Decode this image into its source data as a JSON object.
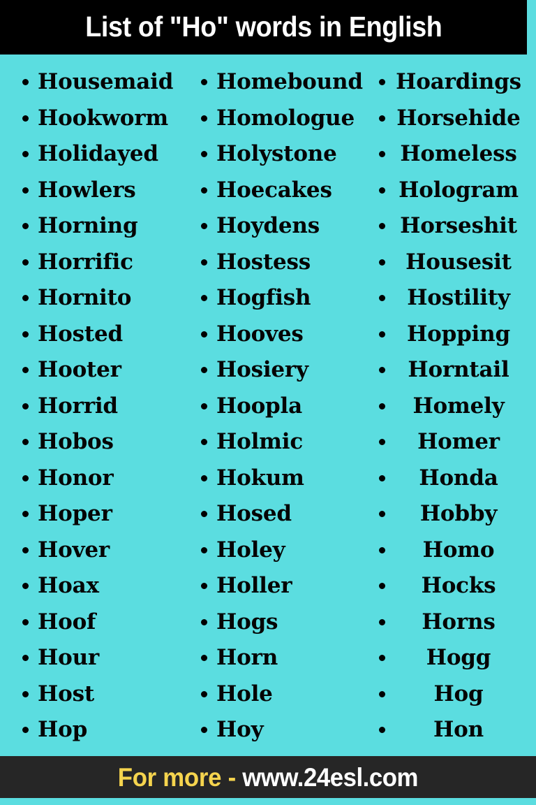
{
  "page": {
    "background_color": "#5BDDE0",
    "header_background": "#000000",
    "footer_background": "#262626",
    "text_color": "#050505",
    "accent_color": "#F5D44E"
  },
  "header": {
    "title": "List of \"Ho\" words in English"
  },
  "columns": [
    {
      "id": "column-1",
      "align": "left",
      "words": [
        "Housemaid",
        "Hookworm",
        "Holidayed",
        "Howlers",
        "Horning",
        "Horrific",
        "Hornito",
        "Hosted",
        "Hooter",
        "Horrid",
        "Hobos",
        "Honor",
        "Hoper",
        "Hover",
        "Hoax",
        "Hoof",
        "Hour",
        "Host",
        "Hop"
      ]
    },
    {
      "id": "column-2",
      "align": "left",
      "words": [
        "Homebound",
        "Homologue",
        "Holystone",
        "Hoecakes",
        "Hoydens",
        "Hostess",
        "Hogfish",
        "Hooves",
        "Hosiery",
        "Hoopla",
        "Holmic",
        "Hokum",
        "Hosed",
        "Holey",
        "Holler",
        "Hogs",
        "Horn",
        "Hole",
        "Hoy"
      ]
    },
    {
      "id": "column-3",
      "align": "center",
      "words": [
        "Hoardings",
        "Horsehide",
        "Homeless",
        "Hologram",
        "Horseshit",
        "Housesit",
        "Hostility",
        "Hopping",
        "Horntail",
        "Homely",
        "Homer",
        "Honda",
        "Hobby",
        "Homo",
        "Hocks",
        "Horns",
        "Hogg",
        "Hog",
        "Hon"
      ]
    }
  ],
  "footer": {
    "cta_label": "For more -",
    "url_label": "www.24esl.com"
  }
}
